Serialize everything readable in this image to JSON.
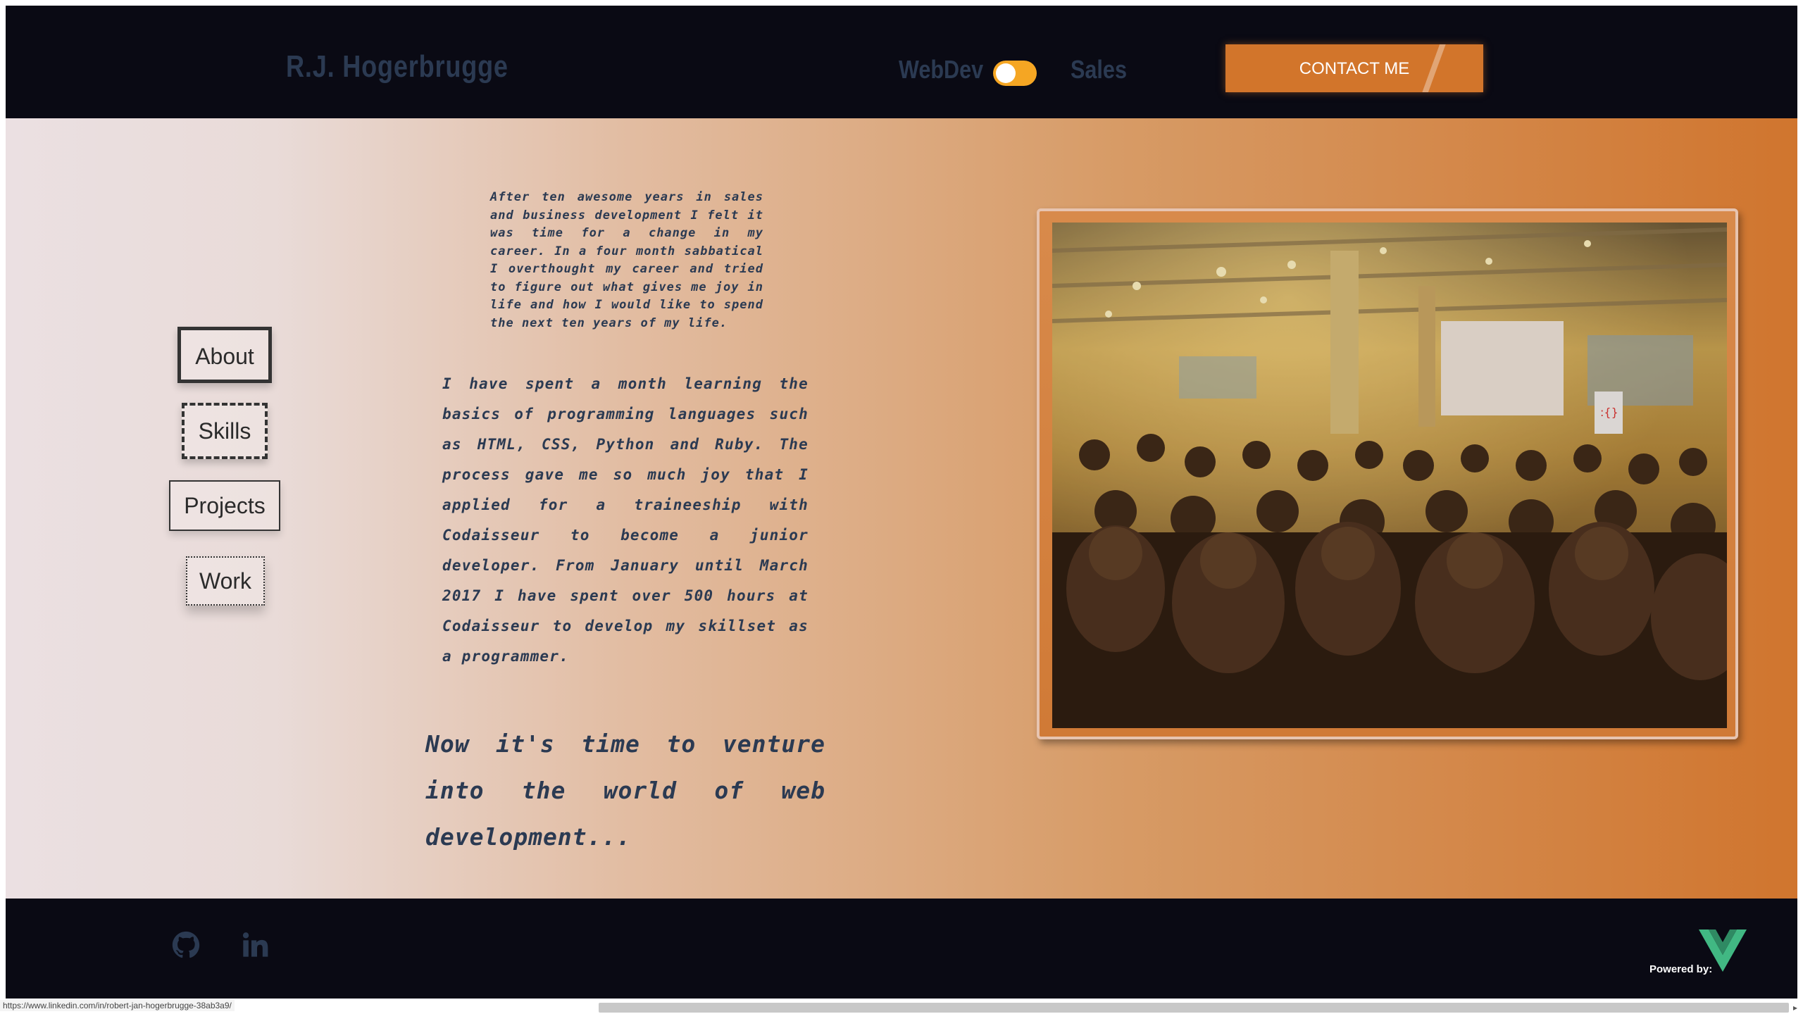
{
  "header": {
    "brand": "R.J. Hogerbrugge",
    "toggle_left_label": "WebDev",
    "toggle_right_label": "Sales",
    "toggle_state": "WebDev",
    "contact_label": "CONTACT ME"
  },
  "sidebar": {
    "items": [
      {
        "label": "About"
      },
      {
        "label": "Skills"
      },
      {
        "label": "Projects"
      },
      {
        "label": "Work"
      }
    ]
  },
  "content": {
    "paragraph1": "After ten awesome years in sales and business development I felt it was time for a change in my career. In a four month sabbatical I overthought my career and tried to figure out what gives me joy in life and how I would like to spend the next ten years of my life.",
    "paragraph2": "I have spent a month learning the basics of programming languages such as HTML, CSS, Python and Ruby. The process gave me so much joy that I applied for a traineeship with Codaisseur to become a junior developer. From January until March 2017 I have spent over 500 hours at Codaisseur to develop my skillset as a programmer.",
    "paragraph3": "Now it's time to venture into the world of web development..."
  },
  "footer": {
    "powered_by": "Powered by:",
    "icons": [
      "github-icon",
      "linkedin-icon",
      "vue-logo"
    ]
  },
  "statusbar": {
    "url": "https://www.linkedin.com/in/robert-jan-hogerbrugge-38ab3a9/"
  },
  "colors": {
    "accent": "#d2752b",
    "dark": "#0a0a14",
    "text": "#2b3a52",
    "toggle": "#f5a623"
  }
}
